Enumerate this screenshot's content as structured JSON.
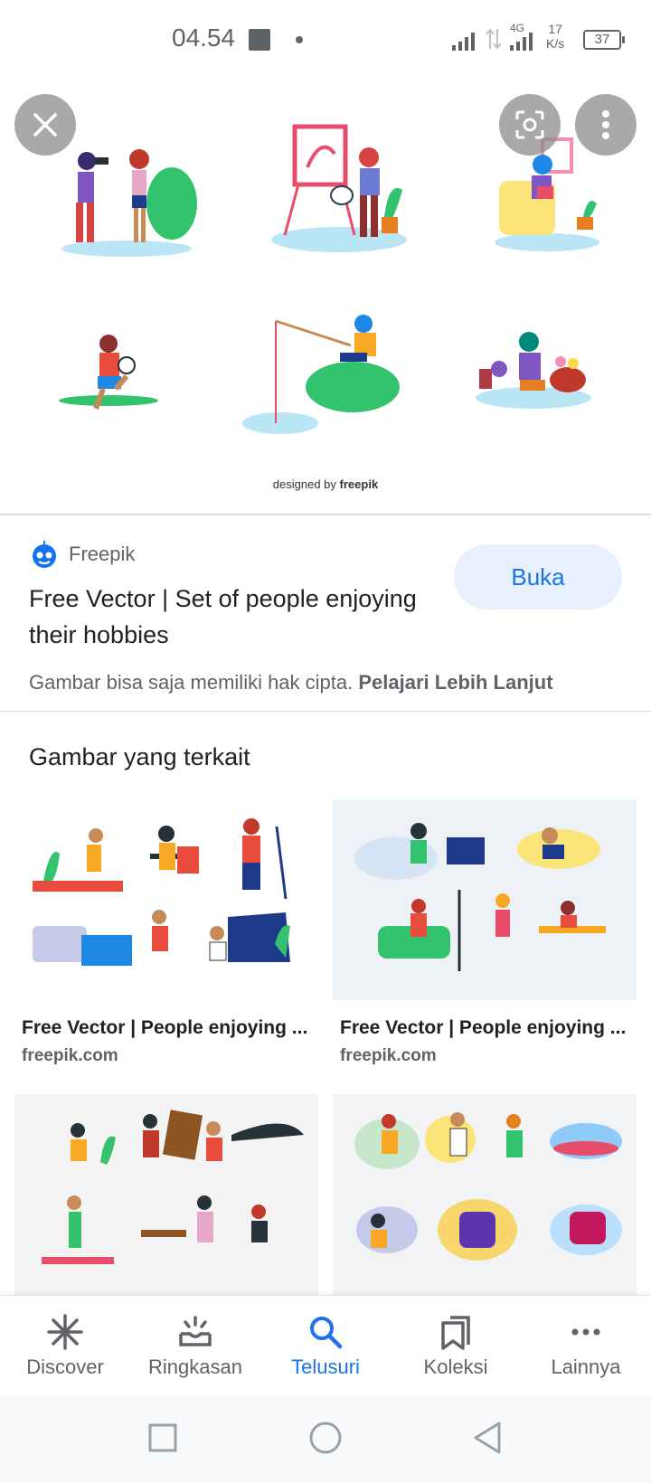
{
  "status_bar": {
    "time": "04.54",
    "network": "4G",
    "speed_value": "17",
    "speed_unit": "K/s",
    "battery": "37"
  },
  "hero": {
    "credit_prefix": "designed by",
    "credit_brand": "freepik"
  },
  "result": {
    "source": "Freepik",
    "title": "Free Vector | Set of people enjoying their hobbies",
    "open_label": "Buka",
    "copyright_text": "Gambar bisa saja memiliki hak cipta.",
    "learn_more": "Pelajari Lebih Lanjut"
  },
  "related": {
    "heading": "Gambar yang terkait",
    "items": [
      {
        "caption": "Free Vector | People enjoying ...",
        "domain": "freepik.com"
      },
      {
        "caption": "Free Vector | People enjoying ...",
        "domain": "freepik.com"
      },
      {
        "caption": "",
        "domain": ""
      },
      {
        "caption": "",
        "domain": ""
      }
    ]
  },
  "bottom_nav": {
    "items": [
      {
        "label": "Discover",
        "icon": "asterisk-icon"
      },
      {
        "label": "Ringkasan",
        "icon": "summary-icon"
      },
      {
        "label": "Telusuri",
        "icon": "search-icon"
      },
      {
        "label": "Koleksi",
        "icon": "bookmarks-icon"
      },
      {
        "label": "Lainnya",
        "icon": "more-horizontal-icon"
      }
    ],
    "active_index": 2
  },
  "colors": {
    "accent": "#1a73e8",
    "button_bg": "#e8f0fe",
    "muted": "#5f6368"
  }
}
